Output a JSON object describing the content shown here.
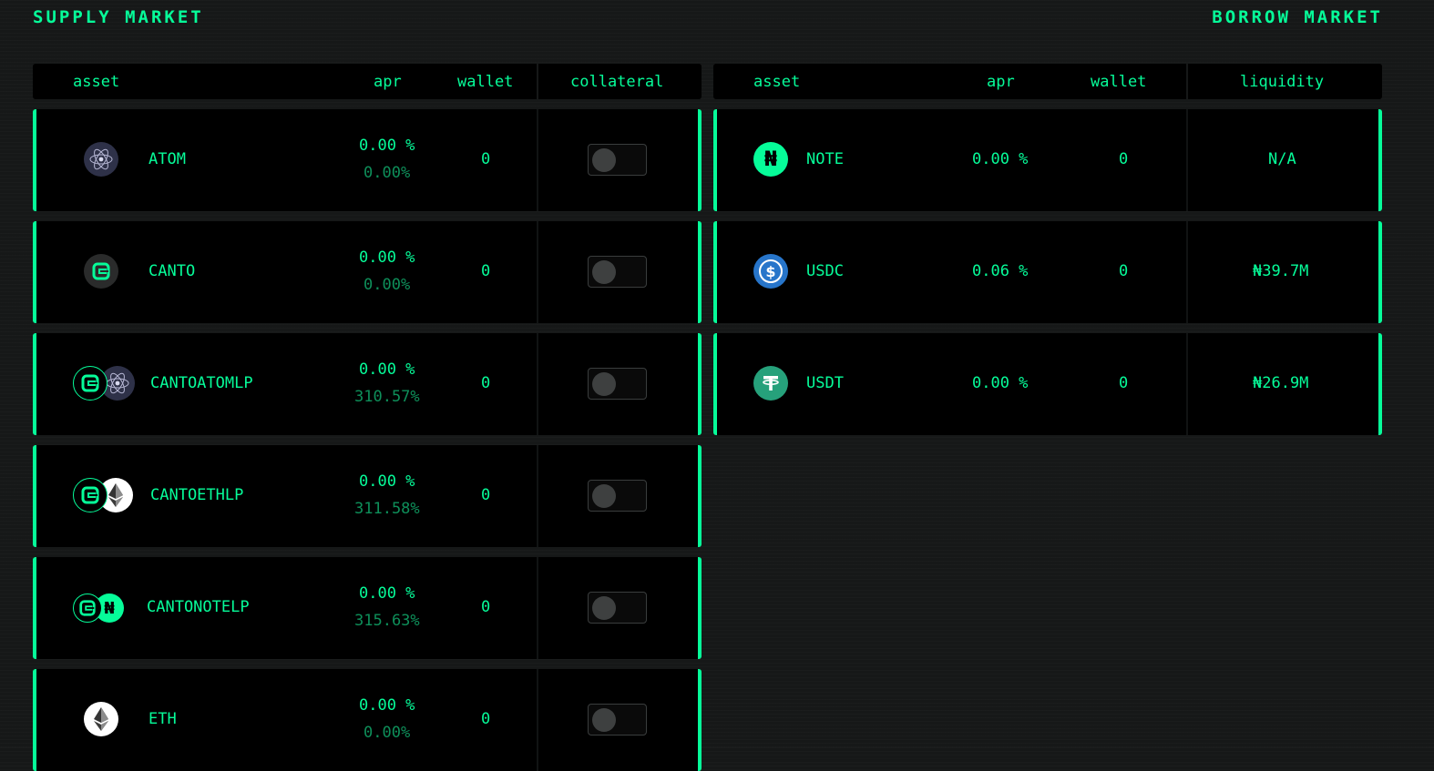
{
  "supply": {
    "title": "SUPPLY MARKET",
    "headers": {
      "asset": "asset",
      "apr": "apr",
      "wallet": "wallet",
      "collateral": "collateral"
    },
    "rows": [
      {
        "icon": "atom-icon",
        "name": "ATOM",
        "apr": "0.00 %",
        "apr_sub": "0.00%",
        "wallet": "0",
        "collateral": false
      },
      {
        "icon": "canto-icon",
        "name": "CANTO",
        "apr": "0.00 %",
        "apr_sub": "0.00%",
        "wallet": "0",
        "collateral": false
      },
      {
        "icon": "canto-atom-lp-icon",
        "name": "CANTOATOMLP",
        "apr": "0.00 %",
        "apr_sub": "310.57%",
        "wallet": "0",
        "collateral": false
      },
      {
        "icon": "canto-eth-lp-icon",
        "name": "CANTOETHLP",
        "apr": "0.00 %",
        "apr_sub": "311.58%",
        "wallet": "0",
        "collateral": false
      },
      {
        "icon": "canto-note-lp-icon",
        "name": "CANTONOTELP",
        "apr": "0.00 %",
        "apr_sub": "315.63%",
        "wallet": "0",
        "collateral": false
      },
      {
        "icon": "eth-icon",
        "name": "ETH",
        "apr": "0.00 %",
        "apr_sub": "0.00%",
        "wallet": "0",
        "collateral": false
      }
    ]
  },
  "borrow": {
    "title": "BORROW MARKET",
    "headers": {
      "asset": "asset",
      "apr": "apr",
      "wallet": "wallet",
      "liquidity": "liquidity"
    },
    "rows": [
      {
        "icon": "note-icon",
        "name": "NOTE",
        "apr": "0.00 %",
        "wallet": "0",
        "liquidity": "N/A"
      },
      {
        "icon": "usdc-icon",
        "name": "USDC",
        "apr": "0.06 %",
        "wallet": "0",
        "liquidity": "₦39.7M"
      },
      {
        "icon": "usdt-icon",
        "name": "USDT",
        "apr": "0.00 %",
        "wallet": "0",
        "liquidity": "₦26.9M"
      }
    ]
  },
  "colors": {
    "accent": "#06fc99",
    "dim_accent": "#0e8f5a",
    "background": "#161818",
    "panel": "#000000"
  }
}
